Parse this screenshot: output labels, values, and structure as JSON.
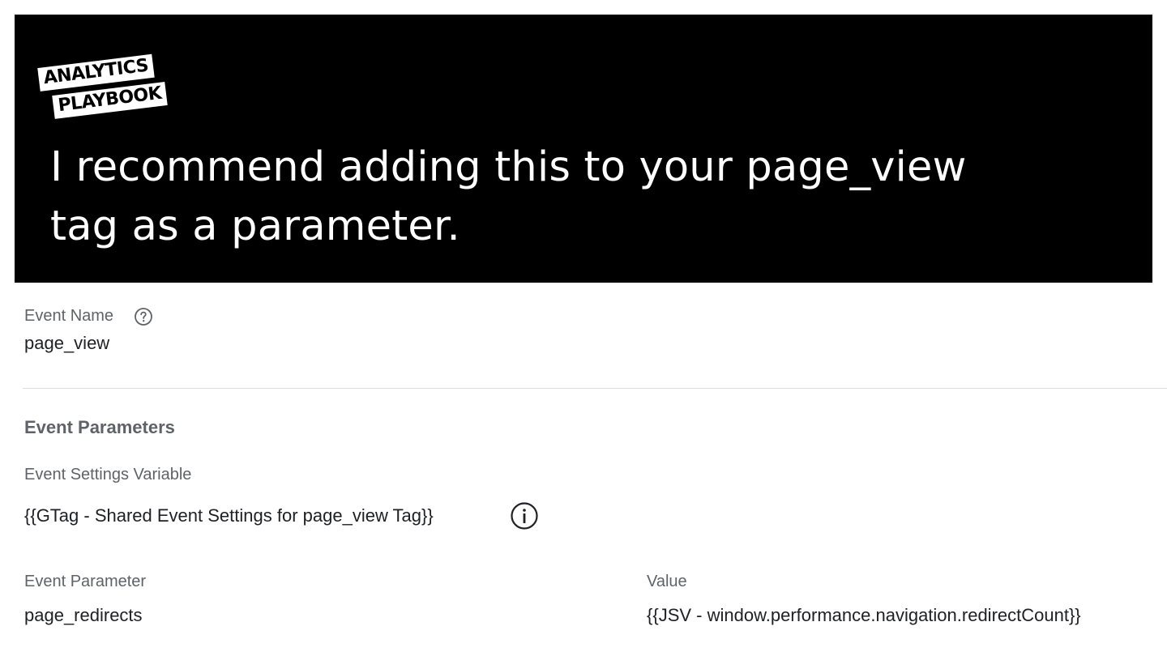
{
  "banner": {
    "logo_line1": "ANALYTICS",
    "logo_line2": "PLAYBOOK",
    "text_line1": "I recommend adding this to your page_view",
    "text_line2": "tag as a parameter."
  },
  "event_name": {
    "label": "Event Name",
    "help_icon": "help-circle-icon",
    "value": "page_view"
  },
  "event_parameters": {
    "title": "Event Parameters",
    "settings_variable_label": "Event Settings Variable",
    "settings_variable_value": "{{GTag - Shared Event Settings for page_view Tag}}",
    "info_icon": "info-circle-icon",
    "param_column_label": "Event Parameter",
    "value_column_label": "Value",
    "rows": [
      {
        "parameter": "page_redirects",
        "value": "{{JSV - window.performance.navigation.redirectCount}}"
      }
    ]
  },
  "colors": {
    "banner_bg": "#000000",
    "banner_text": "#ffffff",
    "label_text": "#5f6368",
    "value_text": "#202124",
    "divider": "#dadce0"
  }
}
